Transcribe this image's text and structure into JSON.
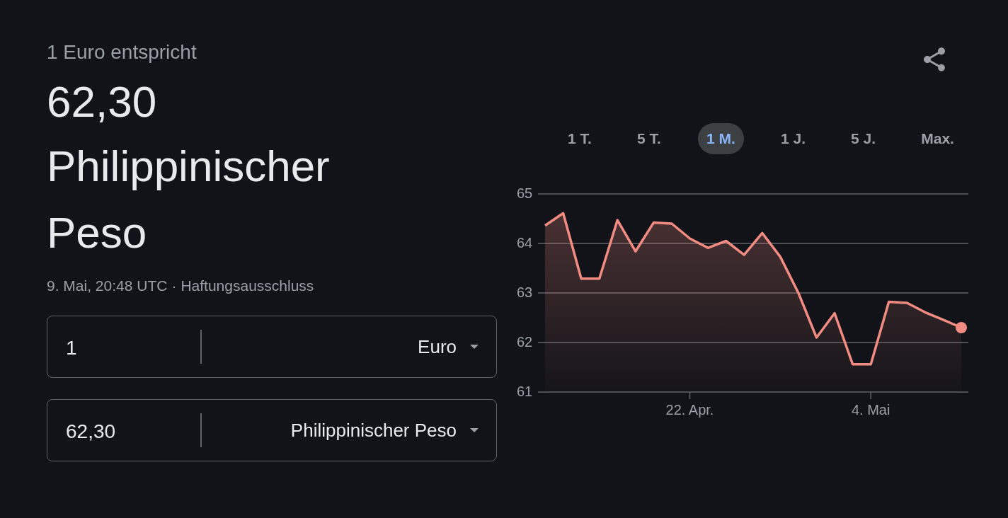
{
  "header": "1 Euro entspricht",
  "rate": "62,30",
  "currency": "Philippinischer Peso",
  "meta": {
    "timestamp": "9. Mai, 20:48 UTC",
    "separator": "·",
    "disclaimer": "Haftungsausschluss"
  },
  "converters": [
    {
      "value": "1",
      "currency": "Euro"
    },
    {
      "value": "62,30",
      "currency": "Philippinischer Peso"
    }
  ],
  "periods": [
    {
      "label": "1 T.",
      "selected": false
    },
    {
      "label": "5 T.",
      "selected": false
    },
    {
      "label": "1 M.",
      "selected": true
    },
    {
      "label": "1 J.",
      "selected": false
    },
    {
      "label": "5 J.",
      "selected": false
    },
    {
      "label": "Max.",
      "selected": false
    }
  ],
  "chart_data": {
    "type": "area",
    "categories": [
      null,
      null,
      null,
      null,
      null,
      null,
      null,
      null,
      "22. Apr.",
      null,
      null,
      null,
      null,
      null,
      null,
      null,
      null,
      null,
      "4. Mai",
      null,
      null,
      null,
      null,
      null
    ],
    "series": [
      {
        "color": "#f28b82",
        "values": [
          64.36,
          64.61,
          63.29,
          63.29,
          64.47,
          63.84,
          64.42,
          64.4,
          64.1,
          63.91,
          64.05,
          63.77,
          64.21,
          63.73,
          63.0,
          62.1,
          62.59,
          61.56,
          61.56,
          62.82,
          62.8,
          62.61,
          62.46,
          62.3
        ]
      }
    ],
    "ylim": [
      61,
      65
    ],
    "yticks": [
      61,
      62,
      63,
      64,
      65
    ],
    "grid": true
  }
}
